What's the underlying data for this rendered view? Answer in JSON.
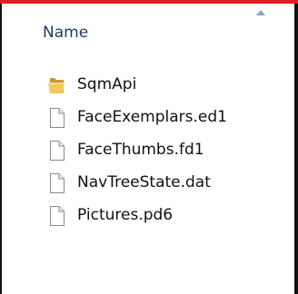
{
  "list": {
    "column_header": "Name",
    "sort_direction": "ascending",
    "items": [
      {
        "name": "SqmApi",
        "type": "folder"
      },
      {
        "name": "FaceExemplars.ed1",
        "type": "file"
      },
      {
        "name": "FaceThumbs.fd1",
        "type": "file"
      },
      {
        "name": "NavTreeState.dat",
        "type": "file"
      },
      {
        "name": "Pictures.pd6",
        "type": "file"
      }
    ]
  },
  "colors": {
    "header_text": "#1e3a5f",
    "folder": "#e8b84a",
    "accent_bar": "#e02020"
  }
}
